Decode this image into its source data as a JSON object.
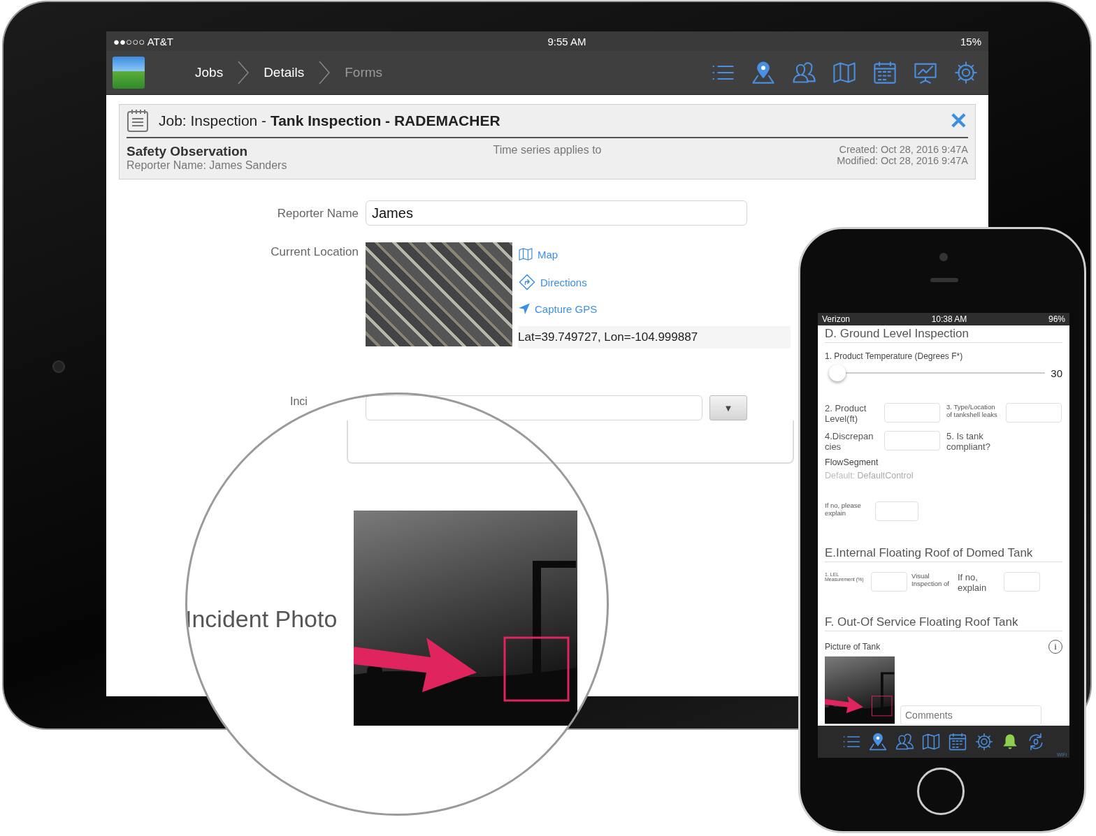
{
  "tablet": {
    "status_bar": {
      "carrier": "●●○○○ AT&T",
      "time": "9:55 AM",
      "battery": "15%"
    },
    "breadcrumbs": [
      {
        "label": "Jobs",
        "disabled": false
      },
      {
        "label": "Details",
        "disabled": false
      },
      {
        "label": "Forms",
        "disabled": true
      }
    ],
    "job_header": {
      "close_button": "✕",
      "title": "Job: Inspection - **Tank Inspection  - RADEMACHER**",
      "form_name": "Safety Observation",
      "reporter": "Reporter Name: James Sanders",
      "center_note": "Time series applies to",
      "created": "Created: Oct 28, 2016 9:47A",
      "modified": "Modified: Oct 28, 2016 9:47A"
    },
    "form": {
      "reporter_name": {
        "label": "Reporter Name",
        "value": "James"
      },
      "location": {
        "label": "Current Location",
        "links": [
          {
            "kind": "map",
            "label": "Map"
          },
          {
            "kind": "directions",
            "label": "Directions"
          },
          {
            "kind": "gps",
            "label": "Capture GPS"
          }
        ],
        "coordinates": "Lat=39.749727, Lon=-104.999887"
      },
      "incident": {
        "label": "Inci",
        "dropdown_button": "▼"
      }
    },
    "magnifier": {
      "label": "Incident Photo"
    }
  },
  "phone": {
    "status_bar": {
      "carrier": "Verizon",
      "time": "10:38 AM",
      "battery": "96%"
    },
    "section_d": {
      "title": "D. Ground Level Inspection",
      "slider": {
        "label": "1. Product Temperature (Degrees F*)",
        "level": 0.02,
        "reading": "30"
      },
      "rows": [
        [
          {
            "label": "2. Product Level(ft)",
            "kind": "normal",
            "has_field": true
          },
          {
            "label": "3. Type/Location of tankshell leaks",
            "kind": "small",
            "has_field": true
          }
        ],
        [
          {
            "label": "4.Discrepancies",
            "kind": "normal",
            "has_field": true
          },
          {
            "label": "5. Is tank compliant?",
            "kind": "normal",
            "has_field": false
          }
        ]
      ],
      "flow_label": "FlowSegment",
      "default_prefix": "Default:",
      "default_value": "DefaultControl",
      "explain": {
        "label": "If no, please explain",
        "kind": "small",
        "has_field": true
      }
    },
    "section_e": {
      "title": "E.Internal Floating Roof of Domed Tank",
      "cells": [
        {
          "label": "1. LEL Measurement (%)",
          "kind": "tiny",
          "has_field": true
        },
        {
          "label": "Visual Inspection of",
          "kind": "small",
          "has_field": false
        },
        {
          "label": "If no, explain",
          "kind": "normal",
          "has_field": true
        }
      ]
    },
    "section_f": {
      "title": "F. Out-Of Service Floating Roof Tank",
      "picture_label": "Picture of Tank",
      "info_button": "i",
      "comments": {
        "placeholder": "Comments"
      }
    },
    "network_label": "WiFi"
  }
}
